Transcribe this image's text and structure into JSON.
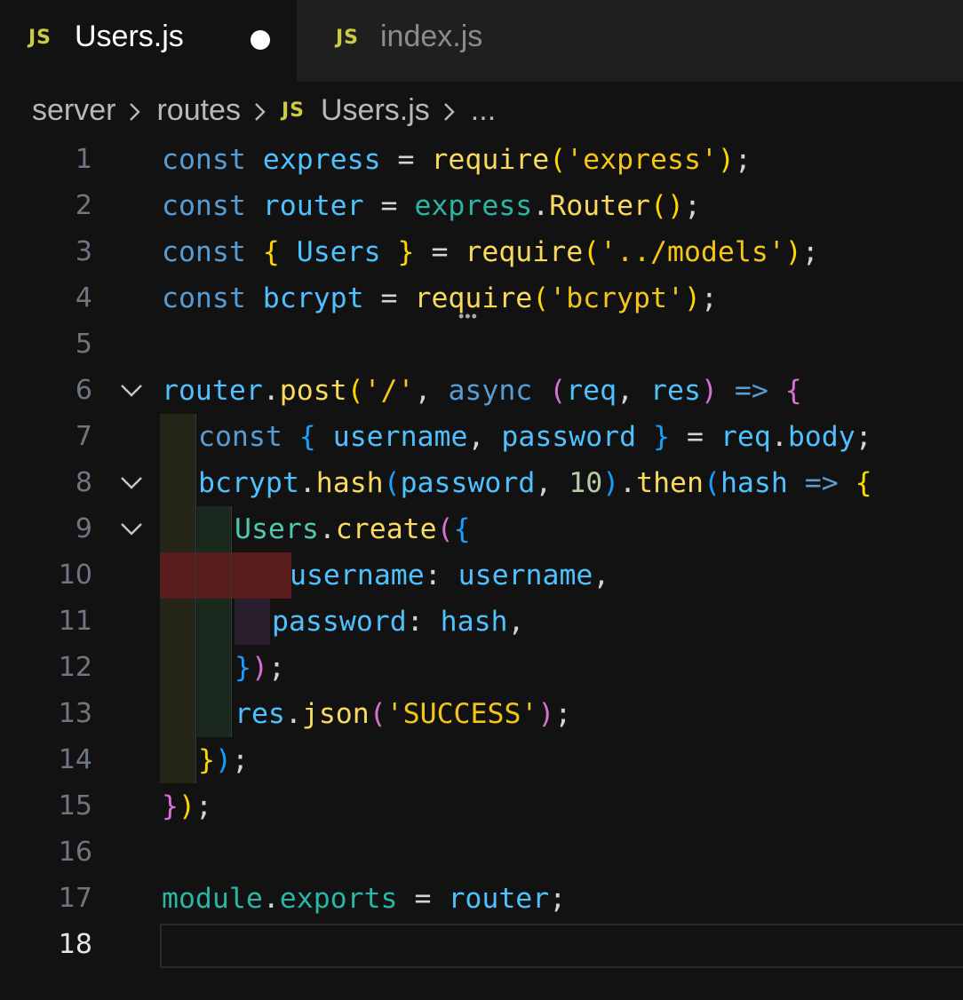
{
  "tabs": [
    {
      "icon": "JS",
      "label": "Users.js",
      "modified": true,
      "active": true
    },
    {
      "icon": "JS",
      "label": "index.js",
      "modified": false,
      "active": false
    }
  ],
  "breadcrumb": {
    "items": [
      "server",
      "routes",
      "Users.js",
      "..."
    ],
    "file_icon": "JS"
  },
  "editor": {
    "current_line": 18,
    "lines": [
      {
        "n": "1"
      },
      {
        "n": "2"
      },
      {
        "n": "3"
      },
      {
        "n": "4"
      },
      {
        "n": "5"
      },
      {
        "n": "6"
      },
      {
        "n": "7"
      },
      {
        "n": "8"
      },
      {
        "n": "9"
      },
      {
        "n": "10"
      },
      {
        "n": "11"
      },
      {
        "n": "12"
      },
      {
        "n": "13"
      },
      {
        "n": "14"
      },
      {
        "n": "15"
      },
      {
        "n": "16"
      },
      {
        "n": "17"
      },
      {
        "n": "18"
      }
    ],
    "code": {
      "l1": {
        "kw": "const",
        "name": "express",
        "eq": " = ",
        "fn": "require",
        "open": "(",
        "str": "'express'",
        "close": ")",
        "semi": ";"
      },
      "l2": {
        "kw": "const",
        "name": "router",
        "eq": " = ",
        "obj": "express",
        "dot": ".",
        "fn": "Router",
        "parens": "()",
        "semi": ";"
      },
      "l3": {
        "kw": "const",
        "lb": "{",
        "name": " Users ",
        "rb": "}",
        "eq": " = ",
        "fn": "require",
        "open": "(",
        "str": "'../models'",
        "close": ")",
        "semi": ";"
      },
      "l4": {
        "kw": "const",
        "name": "bcrypt",
        "eq": " = ",
        "fn": "require",
        "open": "(",
        "str": "'bcrypt'",
        "close": ")",
        "semi": ";"
      },
      "l6": {
        "obj": "router",
        "dot": ".",
        "fn": "post",
        "open": "(",
        "str": "'/'",
        "comma": ", ",
        "kw": "async",
        "sp": " ",
        "popen": "(",
        "p1": "req",
        "pcomma": ", ",
        "p2": "res",
        "pclose": ")",
        "arrow": " => ",
        "brace": "{"
      },
      "l7": {
        "kw": "const",
        "lb": "{",
        "a": " username",
        "c": ", ",
        "b": "password ",
        "rb": "}",
        "eq": " = ",
        "obj": "req",
        "dot": ".",
        "prop": "body",
        "semi": ";"
      },
      "l8": {
        "obj": "bcrypt",
        "dot": ".",
        "fn": "hash",
        "open": "(",
        "arg": "password",
        "comma": ", ",
        "num": "10",
        "close": ")",
        "dot2": ".",
        "fn2": "then",
        "open2": "(",
        "p": "hash",
        "arrow": " => ",
        "brace": "{"
      },
      "l9": {
        "obj": "Users",
        "dot": ".",
        "fn": "create",
        "open": "(",
        "brace": "{"
      },
      "l10": {
        "key": "username",
        "colon": ": ",
        "val": "username",
        "comma": ","
      },
      "l11": {
        "key": "password",
        "colon": ": ",
        "val": "hash",
        "comma": ","
      },
      "l12": {
        "brace": "}",
        "close": ")",
        "semi": ";"
      },
      "l13": {
        "obj": "res",
        "dot": ".",
        "fn": "json",
        "open": "(",
        "str": "'SUCCESS'",
        "close": ")",
        "semi": ";"
      },
      "l14": {
        "brace": "}",
        "close": ")",
        "semi": ";"
      },
      "l15": {
        "brace": "}",
        "close": ")",
        "semi": ";"
      },
      "l17": {
        "obj": "module",
        "dot": ".",
        "prop": "exports",
        "eq": " = ",
        "val": "router",
        "semi": ";"
      }
    }
  }
}
